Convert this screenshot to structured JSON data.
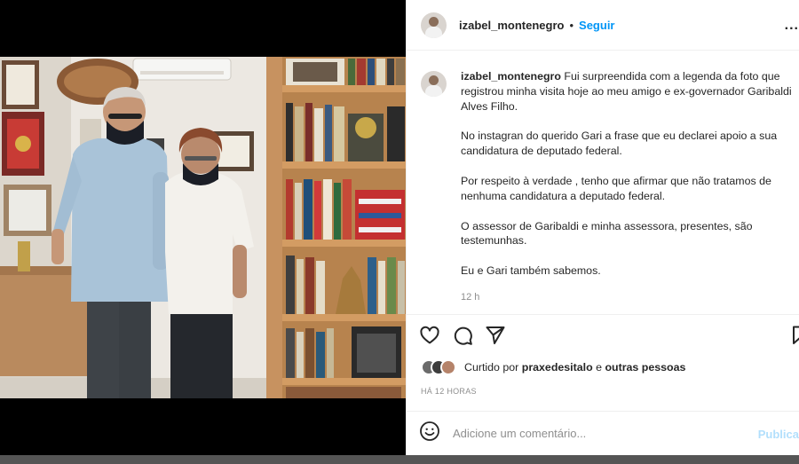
{
  "post": {
    "username": "izabel_montenegro",
    "follow_label": "Seguir",
    "separator": "•",
    "more_label": "...",
    "photo_alt": "izabel_montenegro photo"
  },
  "caption": {
    "username": "izabel_montenegro",
    "paragraphs": [
      "Fui surpreendida com a legenda da foto que registrou minha visita hoje ao meu amigo e ex-governador Garibaldi Alves Filho.",
      "No instagran do querido Gari a frase que eu declarei apoio a sua candidatura de deputado federal.",
      "Por respeito à verdade , tenho que afirmar que não tratamos de nenhuma candidatura a deputado federal.",
      "O assessor de Garibaldi e minha assessora, presentes, são testemunhas.",
      "Eu e Gari também sabemos."
    ],
    "time": "12 h"
  },
  "likes": {
    "prefix": "Curtido por",
    "user": "praxedesitalo",
    "connector": "e",
    "others": "outras pessoas"
  },
  "date_label": "HÁ 12 HORAS",
  "comment": {
    "placeholder": "Adicione um comentário...",
    "publish_label": "Publica"
  },
  "icons": {
    "like": "heart-icon",
    "comment": "comment-icon",
    "share": "send-icon",
    "save": "bookmark-icon",
    "emoji": "smile-icon",
    "more": "more-icon"
  },
  "colors": {
    "accent": "#0095f6",
    "publish_disabled": "#b2dffc",
    "text": "#262626",
    "muted": "#8e8e8e"
  }
}
